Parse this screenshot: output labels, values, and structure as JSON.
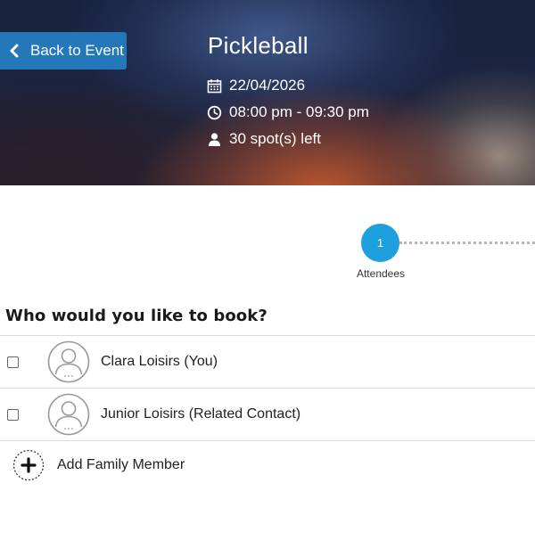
{
  "header": {
    "back_label": "Back to Event",
    "title": "Pickleball",
    "date": "22/04/2026",
    "time": "08:00 pm - 09:30 pm",
    "spots": "30 spot(s) left"
  },
  "stepper": {
    "steps": [
      {
        "number": "1",
        "label": "Attendees"
      }
    ],
    "accent": "#1ea0df"
  },
  "booking": {
    "question": "Who would you like to book?",
    "attendees": [
      {
        "name": "Clara Loisirs (You)"
      },
      {
        "name": "Junior Loisirs (Related Contact)"
      }
    ],
    "add_label": "Add Family Member"
  },
  "colors": {
    "button": "#2478b9",
    "step": "#1ea0df"
  },
  "icons": [
    "chevron-left-icon",
    "calendar-icon",
    "clock-icon",
    "user-icon",
    "avatar-icon",
    "plus-icon"
  ]
}
